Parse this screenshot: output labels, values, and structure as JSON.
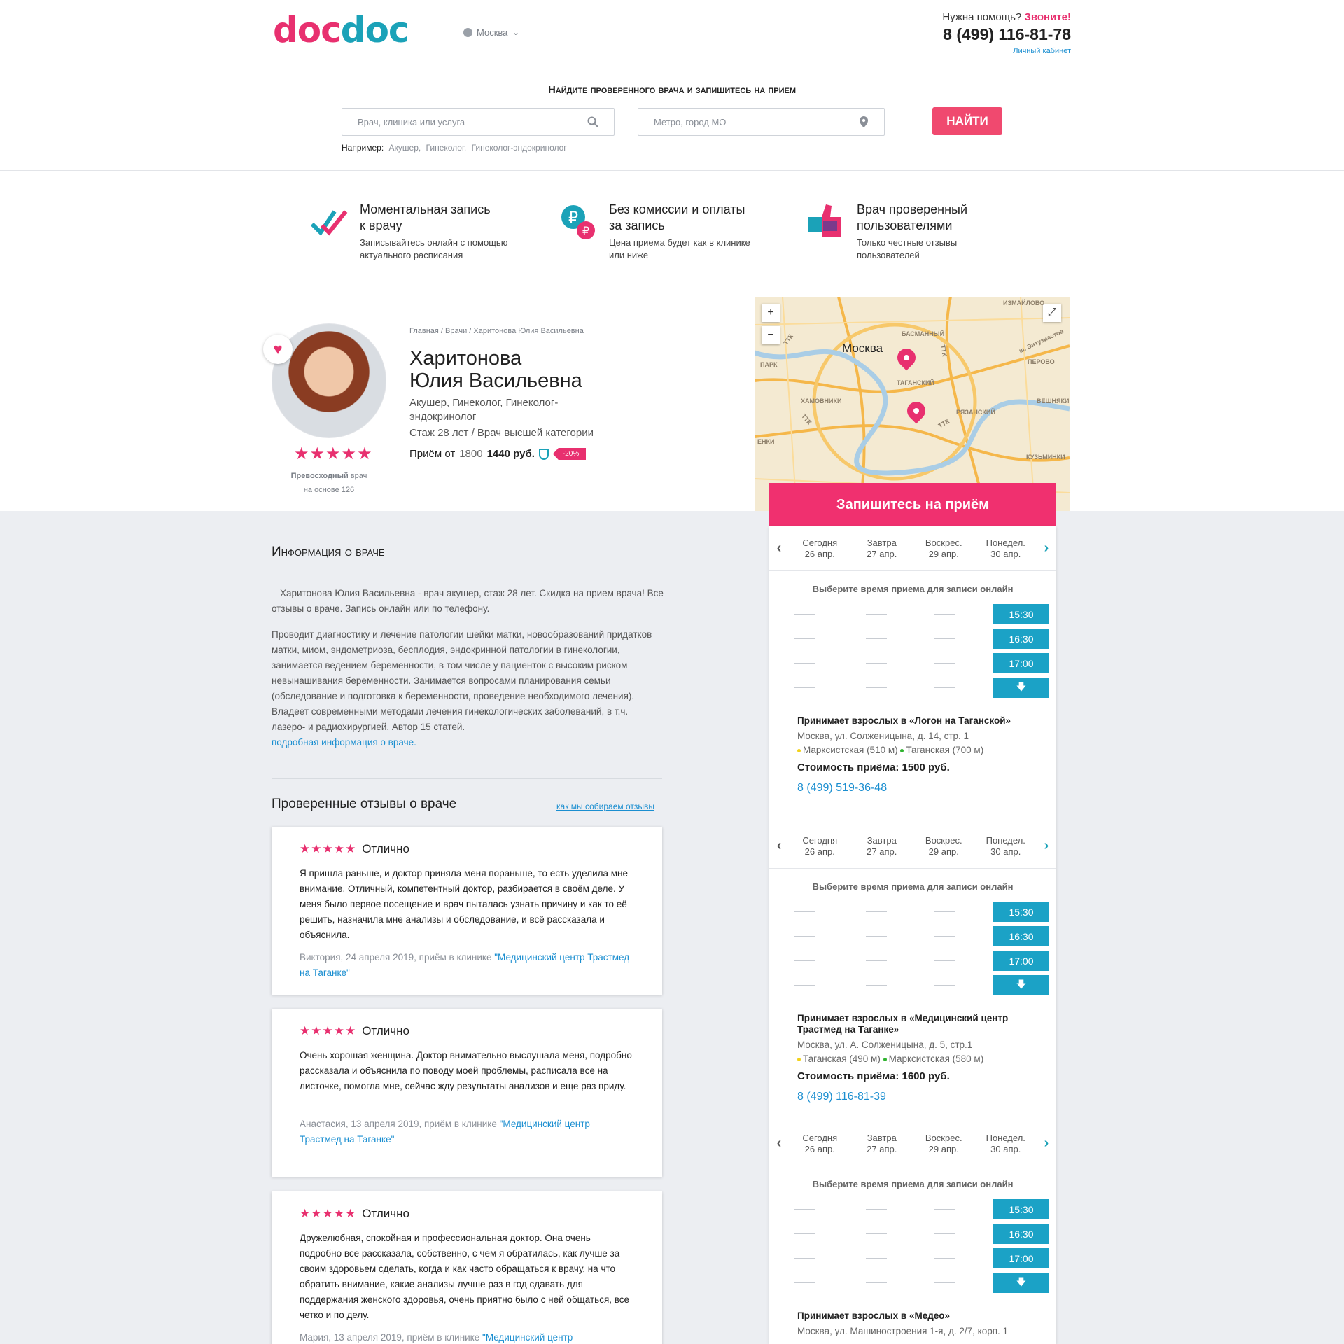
{
  "header": {
    "logo_a": "doc",
    "logo_b": "doc",
    "city": "Москва",
    "help_text": "Нужна помощь?",
    "help_call": "Звоните!",
    "phone": "8 (499) 116-81-78",
    "cabinet": "Личный кабинет"
  },
  "search": {
    "title": "Найдите проверенного врача и  запишитесь на прием",
    "doctor_placeholder": "Врач, клиника или услуга",
    "metro_placeholder": "Метро, город МО",
    "button": "НАЙТИ",
    "examples_label": "Например:",
    "examples": [
      "Акушер,",
      "Гинеколог,",
      "Гинеколог-эндокринолог"
    ]
  },
  "features": [
    {
      "icon": "double-check-icon",
      "title1": "Моментальная запись",
      "title2": "к врачу",
      "text1": "Записывайтесь онлайн с помощью",
      "text2": "актуального расписания"
    },
    {
      "icon": "ruble-coins-icon",
      "title1": "Без комиссии и оплаты",
      "title2": "за запись",
      "text1": "Цена приема будет как в клинике",
      "text2": "или ниже"
    },
    {
      "icon": "thumbs-up-icon",
      "title1": "Врач проверенный",
      "title2": "пользователями",
      "text1": "Только честные отзывы",
      "text2": "пользователей"
    }
  ],
  "doctor": {
    "breadcrumb": "Главная / Врачи / Харитонова Юлия Васильевна",
    "last_name": "Харитонова",
    "first_name": "Юлия Васильевна",
    "specialties": "Акушер, Гинеколог, Гинеколог-эндокринолог",
    "experience": "Стаж 28 лет / Врач высшей категории",
    "price_label": "Приём от",
    "price_old": "1800",
    "price_new": "1440 руб.",
    "discount": "-20%",
    "stars": "★★★★★",
    "rating_label": "Превосходный",
    "rating_sub": "врач",
    "rating_based": "на основе 126"
  },
  "map": {
    "city_label": "Москва",
    "labels": [
      "ИЗМАЙЛОВО",
      "БАСМАННЫЙ",
      "ш. Энтузиастов",
      "ТАГАНСКИЙ",
      "ПЕРОВО",
      "ХАМОВНИКИ",
      "РЯЗАНСКИЙ",
      "ВЕШНЯКИ",
      "КУЗЬМИНКИ",
      "ТТК",
      "ТТК",
      "ТТК",
      "ТТК",
      "ПАРК",
      "ЕНКИ"
    ],
    "zoom_in": "+",
    "zoom_out": "−",
    "expand": "⤢"
  },
  "info": {
    "title": "Информация о враче",
    "p1": "Харитонова Юлия Васильевна - врач акушер, стаж 28 лет. Скидка на прием врача! Все отзывы о враче. Запись онлайн или по телефону.",
    "p2": "Проводит диагностику и лечение патологии шейки матки, новообразований придатков матки, миом, эндометриоза, бесплодия, эндокринной патологии в гинекологии, занимается ведением беременности, в том числе у пациенток с высоким риском невынашивания беременности. Занимается вопросами планирования семьи (обследование и подготовка к беременности, проведение необходимого лечения). Владеет современными методами лечения гинекологических заболеваний, в т.ч. лазеро- и радиохирургией. Автор 15 статей.",
    "more_link": "подробная информация о враче."
  },
  "reviews": {
    "title": "Проверенные отзывы о враче",
    "how_link": "как мы собираем отзывы",
    "items": [
      {
        "stars": "★★★★★",
        "grade": "Отлично",
        "text": "Я пришла раньше, и доктор приняла меня пораньше, то есть уделила мне внимание. Отличный, компетентный доктор, разбирается в своём деле. У меня было первое посещение и врач пыталась узнать причину и как то её решить, назначила мне анализы и обследование, и всё рассказала и объяснила.",
        "meta": "Виктория, 24 апреля 2019, приём в клинике",
        "clinic": "\"Медицинский центр Трастмед на Таганке\""
      },
      {
        "stars": "★★★★★",
        "grade": "Отлично",
        "text": "Очень хорошая женщина. Доктор внимательно выслушала меня, подробно рассказала и объяснила по поводу моей проблемы, расписала все на листочке, помогла мне, сейчас жду результаты анализов и еще раз приду.",
        "meta": "Анастасия, 13 апреля 2019, приём в клинике",
        "clinic": "\"Медицинский центр Трастмед на Таганке\""
      },
      {
        "stars": "★★★★★",
        "grade": "Отлично",
        "text": "Дружелюбная, спокойная и профессиональная доктор. Она очень подробно все рассказала, собственно, с чем я обратилась, как лучше за своим здоровьем сделать, когда и как часто обращаться к врачу, на что обратить внимание, какие анализы лучше раз в год сдавать для поддержания женского здоровья, очень приятно было с ней общаться, все четко и по делу.",
        "meta": "Мария, 13 апреля 2019, приём в клинике",
        "clinic": "\"Медицинский центр"
      }
    ]
  },
  "booking": {
    "title": "Запишитесь на приём",
    "pick_label": "Выберите время приема для записи онлайн",
    "days": [
      {
        "name": "Сегодня",
        "date": "26 апр."
      },
      {
        "name": "Завтра",
        "date": "27 апр."
      },
      {
        "name": "Воскрес.",
        "date": "29 апр."
      },
      {
        "name": "Понедел.",
        "date": "30 апр."
      }
    ],
    "slots": [
      "15:30",
      "16:30",
      "17:00"
    ],
    "more_icon": "arrow-down-icon",
    "clinics": [
      {
        "name": "Принимает взрослых в «Логон на Таганской»",
        "address": "Москва, ул. Солженицына, д. 14, стр. 1",
        "metro1": "Марксистская (510 м)",
        "metro2": "Таганская (700 м)",
        "cost": "Стоимость приёма: 1500 руб.",
        "phone": "8 (499) 519-36-48"
      },
      {
        "name": "Принимает взрослых в «Медицинский центр Трастмед на Таганке»",
        "address": "Москва, ул. А. Солженицына, д. 5, стр.1",
        "metro1": "Таганская (490 м)",
        "metro2": "Марксистская (580 м)",
        "cost": "Стоимость приёма: 1600 руб.",
        "phone": "8 (499) 116-81-39"
      },
      {
        "name": "Принимает взрослых в «Медео»",
        "address": "Москва, ул. Машиностроения 1-я, д. 2/7, корп. 1"
      }
    ]
  },
  "colors": {
    "brand_pink": "#e8306f",
    "brand_teal": "#1ba2b8",
    "slot": "#1ba2c6",
    "link": "#1a8ed0"
  }
}
